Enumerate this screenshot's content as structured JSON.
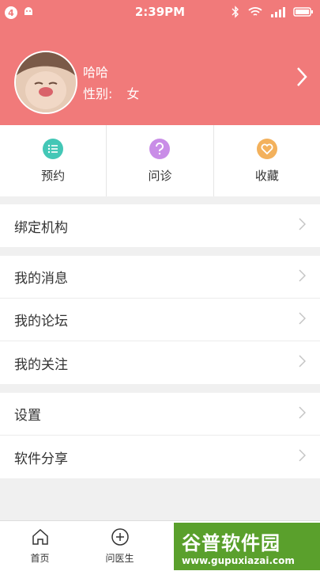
{
  "status": {
    "notif_count": "4",
    "time": "2:39PM"
  },
  "profile": {
    "name": "哈哈",
    "gender_label": "性别:",
    "gender_value": "女"
  },
  "quick_actions": [
    {
      "label": "预约",
      "icon": "list-icon",
      "color": "#43c7b6"
    },
    {
      "label": "问诊",
      "icon": "question-icon",
      "color": "#c98de7"
    },
    {
      "label": "收藏",
      "icon": "heart-icon",
      "color": "#f3b15c"
    }
  ],
  "menu": {
    "bind": "绑定机构",
    "messages": "我的消息",
    "forum": "我的论坛",
    "follow": "我的关注",
    "settings": "设置",
    "share": "软件分享"
  },
  "tabs": {
    "home": "首页",
    "ask_doctor": "问医生"
  },
  "watermark": {
    "title": "谷普软件园",
    "url": "www.gupuxiazai.com"
  }
}
